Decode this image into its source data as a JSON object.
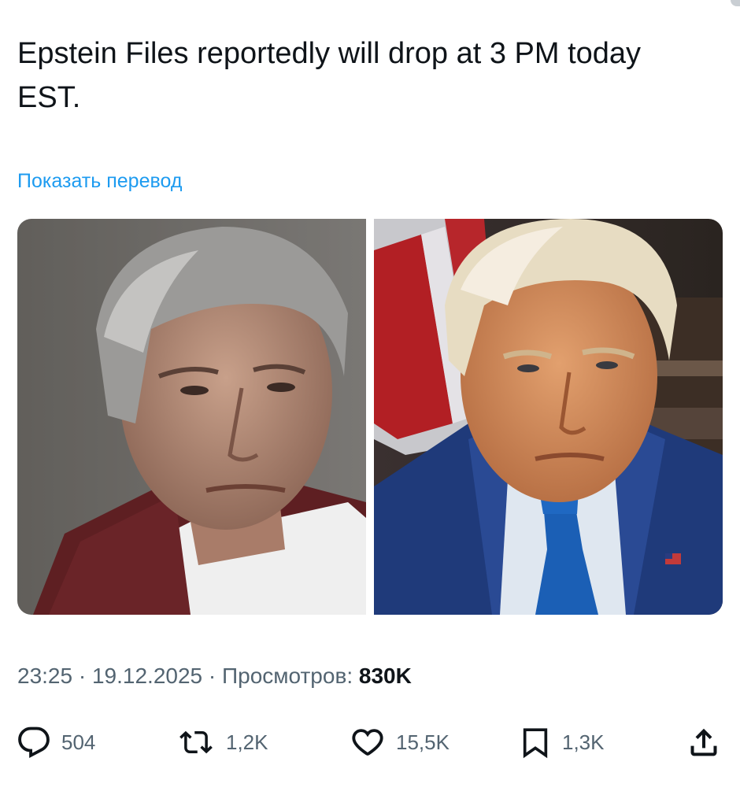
{
  "tweet": {
    "text": "Epstein Files reportedly will drop at 3 PM today EST.",
    "translate_link": "Показать перевод"
  },
  "media": {
    "images": [
      {
        "description_icon": "portrait-photo-left"
      },
      {
        "description_icon": "portrait-photo-right"
      }
    ]
  },
  "meta": {
    "time": "23:25",
    "separator": "·",
    "date": "19.12.2025",
    "views_label": "Просмотров:",
    "views_count": "830K"
  },
  "actions": {
    "reply": {
      "icon": "reply-icon",
      "count": "504"
    },
    "retweet": {
      "icon": "retweet-icon",
      "count": "1,2K"
    },
    "like": {
      "icon": "heart-icon",
      "count": "15,5K"
    },
    "bookmark": {
      "icon": "bookmark-icon",
      "count": "1,3K"
    },
    "share": {
      "icon": "share-icon"
    }
  },
  "colors": {
    "text_primary": "#0f1419",
    "text_secondary": "#536471",
    "link": "#1d9bf0"
  }
}
